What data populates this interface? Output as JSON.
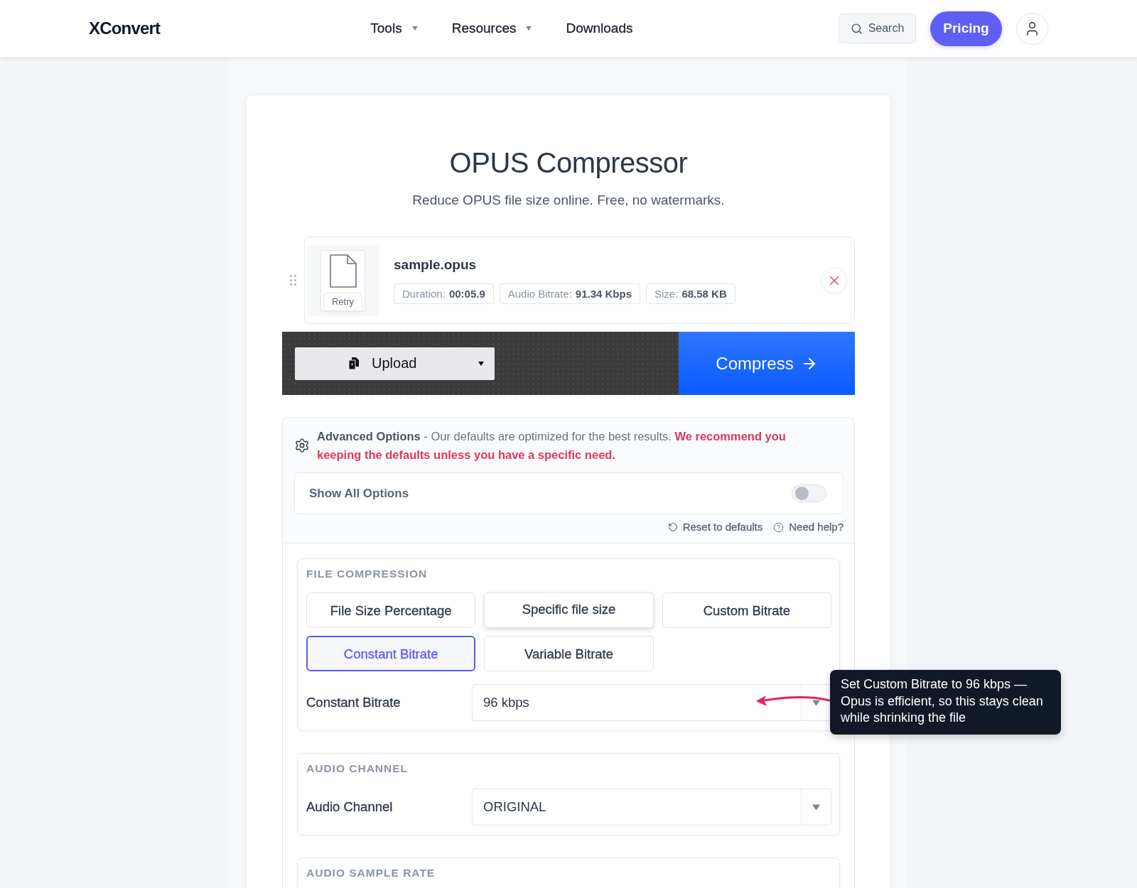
{
  "header": {
    "logo": "XConvert",
    "nav": [
      {
        "label": "Tools",
        "dropdown": true
      },
      {
        "label": "Resources",
        "dropdown": true
      },
      {
        "label": "Downloads",
        "dropdown": false
      }
    ],
    "search": {
      "label": "Search"
    },
    "pricing": "Pricing"
  },
  "page": {
    "title": "OPUS Compressor",
    "subtitle": "Reduce OPUS file size online. Free, no watermarks."
  },
  "file": {
    "name": "sample.opus",
    "retry": "Retry",
    "meta": [
      {
        "label": "Duration:",
        "value": "00:05.9"
      },
      {
        "label": "Audio Bitrate:",
        "value": "91.34 Kbps"
      },
      {
        "label": "Size:",
        "value": "68.58 KB"
      }
    ]
  },
  "actions": {
    "upload": "Upload",
    "compress": "Compress"
  },
  "advanced": {
    "intro": "**Advanced Options** - Our defaults are optimized for the best results.",
    "warning": "We recommend you keeping the defaults unless you have a specific need.",
    "show_all": {
      "label": "Show All Options",
      "on": false
    },
    "links": [
      {
        "kind": "reset",
        "label": "Reset to defaults"
      },
      {
        "kind": "help",
        "label": "Need help?"
      }
    ]
  },
  "sections": [
    {
      "heading": "FILE COMPRESSION",
      "options": [
        {
          "label": "File Size Percentage",
          "selected": false,
          "hovered": false
        },
        {
          "label": "Specific file size",
          "selected": false,
          "hovered": true
        },
        {
          "label": "Custom Bitrate",
          "selected": false,
          "hovered": false
        },
        {
          "label": "Constant Bitrate",
          "selected": true,
          "hovered": false
        },
        {
          "label": "Variable Bitrate",
          "selected": false,
          "hovered": false
        }
      ],
      "fields": [
        {
          "label": "Constant Bitrate",
          "value": "96 kbps",
          "tooltip": {
            "text": "Set Custom Bitrate to 96 kbps — Opus is efficient, so this stays clean while shrinking the file"
          }
        }
      ]
    },
    {
      "heading": "AUDIO CHANNEL",
      "fields": [
        {
          "label": "Audio Channel",
          "value": "ORIGINAL"
        }
      ]
    },
    {
      "heading": "AUDIO SAMPLE RATE"
    }
  ]
}
